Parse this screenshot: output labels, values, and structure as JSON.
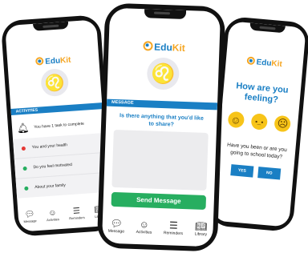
{
  "brand": {
    "name_main": "Edu",
    "name_accent": "Kit",
    "primary": "#1a7fc4",
    "accent": "#f5a623",
    "green": "#27ae60",
    "red": "#e53935"
  },
  "left_phone": {
    "section_title": "ACTIVITIES",
    "task_text": "You have 1 task to complete",
    "items": [
      {
        "label": "You and your health",
        "dot": "#e53935"
      },
      {
        "label": "Do you feel motivated",
        "dot": "#27ae60"
      },
      {
        "label": "About your family",
        "dot": "#27ae60"
      }
    ],
    "nav": [
      "Message",
      "Activities",
      "Reminders",
      "Library"
    ]
  },
  "center_phone": {
    "section_title": "MESSAGE",
    "prompt": "Is there anything that you'd like to share?",
    "message_placeholder": "",
    "send_label": "Send Message",
    "nav": [
      "Message",
      "Activities",
      "Reminders",
      "Library"
    ]
  },
  "right_phone": {
    "question": "How are you feeling?",
    "emojis": [
      "happy-face",
      "neutral-face",
      "sad-face"
    ],
    "school_question": "Have you been or are you going to school today?",
    "yes_label": "YES",
    "no_label": "NO"
  }
}
